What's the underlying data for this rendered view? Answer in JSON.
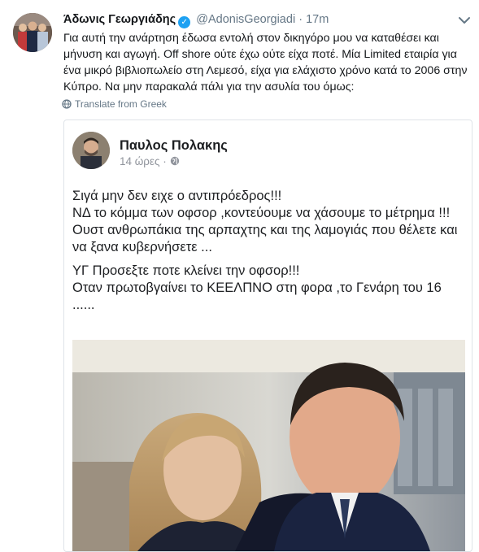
{
  "tweet": {
    "author_name": "Άδωνις Γεωργιάδης",
    "handle": "@AdonisGeorgiadi",
    "separator": "·",
    "time": "17m",
    "text": "Για αυτή την ανάρτηση έδωσα εντολή στον δικηγόρο μου να καταθέσει και μήνυση και αγωγή. Off shore ούτε έχω ούτε είχα ποτέ. Μία Limited εταιρία για ένα μικρό βιβλιοπωλείο στη Λεμεσό, είχα για ελάχιστο χρόνο κατά το 2006 στην Κύπρο. Να μην παρακαλά πάλι για την ασυλία του όμως:",
    "translate_label": "Translate from Greek"
  },
  "quoted_post": {
    "author_name": "Παυλος Πολακης",
    "time": "14 ώρες",
    "time_separator": "·",
    "paragraph_1": "Σιγά μην δεν ειχε ο αντιπρόεδρος!!!\nΝΔ το κόμμα των οφσορ ,κοντεύουμε να χάσουμε το μέτρημα !!!\nΟυστ ανθρωπάκια της αρπαχτης και της λαμογιάς που θέλετε και να ξανα κυβερνήσετε ...",
    "paragraph_2": "ΥΓ Προσεξτε ποτε κλείνει την οφσορ!!!\nΟταν πρωτοβγαίνει το ΚΕΕΛΠΝΟ στη φορα ,το Γενάρη του 16 ......"
  },
  "colors": {
    "link_blue": "#1da1f2",
    "muted": "#657786",
    "fb_text": "#1c1e21",
    "fb_muted": "#90949c"
  },
  "icons": {
    "verified": "verified-badge-icon",
    "caret": "chevron-down-icon",
    "translate": "globe-icon",
    "privacy": "globe-icon"
  }
}
